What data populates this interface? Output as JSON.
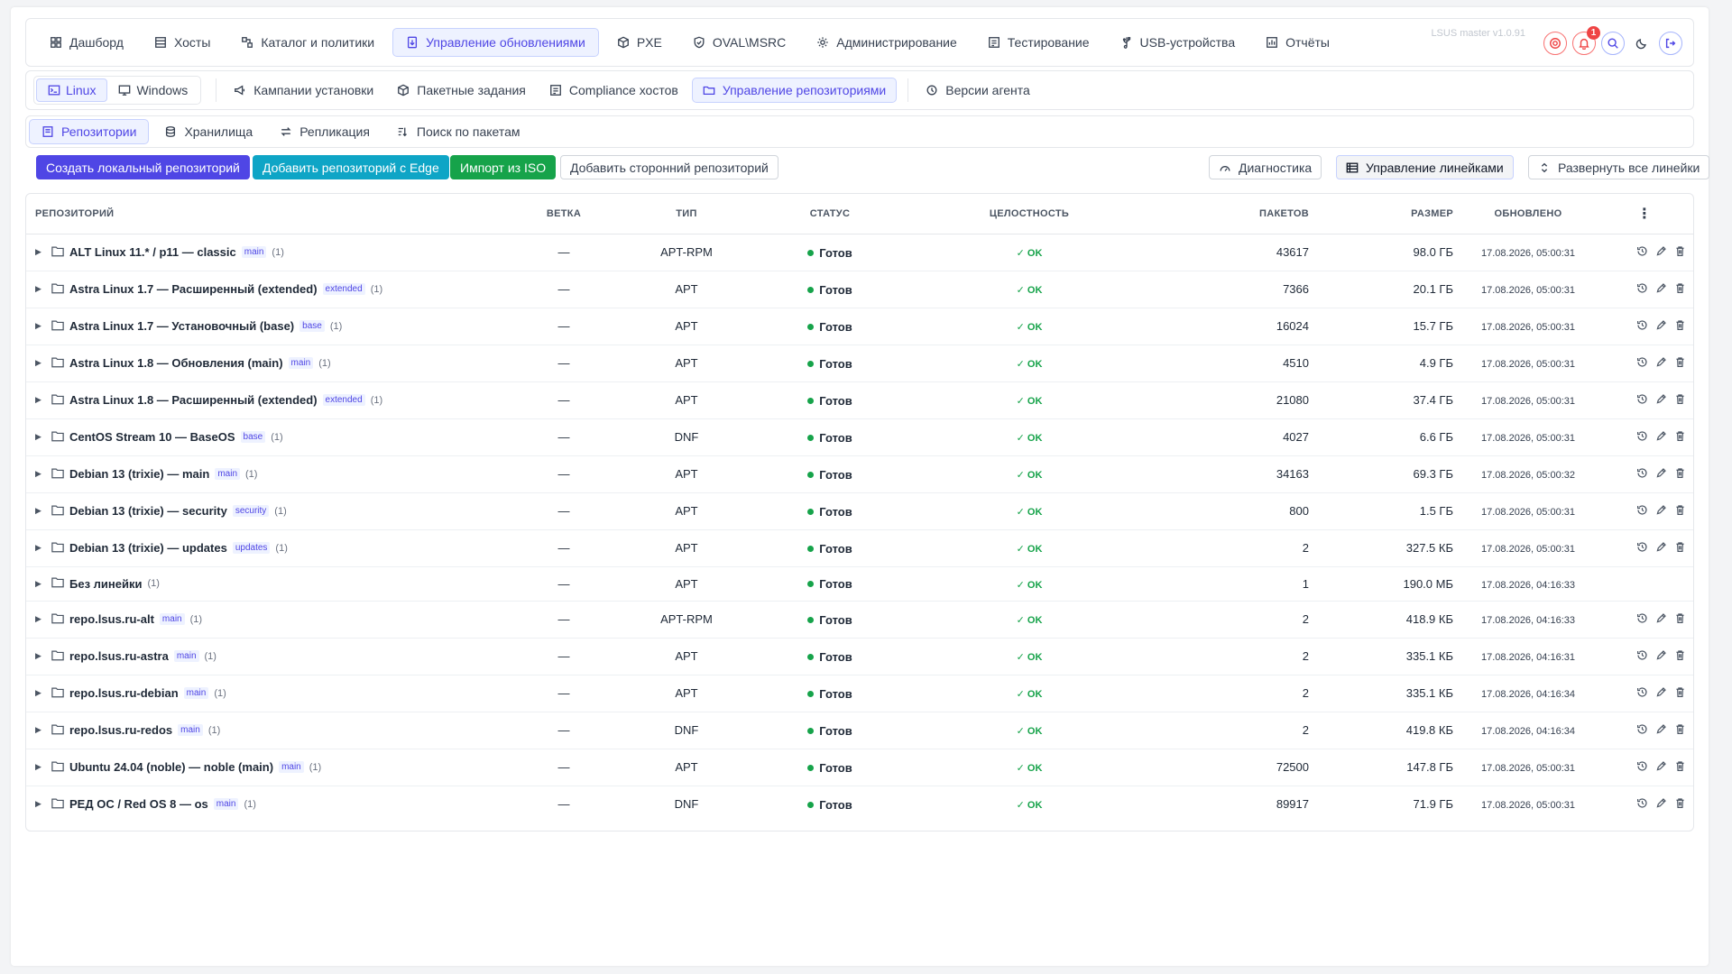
{
  "topnav": {
    "items": [
      {
        "label": "Дашборд",
        "icon": "dashboard-icon"
      },
      {
        "label": "Хосты",
        "icon": "server-icon"
      },
      {
        "label": "Каталог и политики",
        "icon": "catalog-icon"
      },
      {
        "label": "Управление обновлениями",
        "icon": "update-icon",
        "active": true
      },
      {
        "label": "PXE",
        "icon": "cube-icon"
      },
      {
        "label": "OVAL\\MSRC",
        "icon": "shield-icon"
      },
      {
        "label": "Администрирование",
        "icon": "gear-icon"
      },
      {
        "label": "Тестирование",
        "icon": "test-icon"
      },
      {
        "label": "USB-устройства",
        "icon": "usb-icon"
      },
      {
        "label": "Отчёты",
        "icon": "report-icon"
      }
    ],
    "version": "LSUS master v1.0.91",
    "notification_count": "1"
  },
  "subnav": {
    "os": [
      {
        "label": "Linux",
        "active": true
      },
      {
        "label": "Windows"
      }
    ],
    "items": [
      {
        "label": "Кампании установки"
      },
      {
        "label": "Пакетные задания"
      },
      {
        "label": "Compliance хостов"
      },
      {
        "label": "Управление репозиториями",
        "active": true
      },
      {
        "label": "Версии агента"
      }
    ]
  },
  "tabs": [
    {
      "label": "Репозитории",
      "active": true
    },
    {
      "label": "Хранилища"
    },
    {
      "label": "Репликация"
    },
    {
      "label": "Поиск по пакетам"
    }
  ],
  "toolbar": {
    "create_local": "Создать локальный репозиторий",
    "add_edge": "Добавить репозиторий с Edge",
    "import_iso": "Импорт из ISO",
    "add_external": "Добавить сторонний репозиторий",
    "diagnostics": "Диагностика",
    "manage_lines": "Управление линейками",
    "expand_all": "Развернуть все линейки"
  },
  "table": {
    "headers": {
      "repo": "Репозиторий",
      "branch": "Ветка",
      "type": "Тип",
      "status": "Статус",
      "integrity": "Целостность",
      "packages": "Пакетов",
      "size": "Размер",
      "updated": "Обновлено"
    },
    "rows": [
      {
        "name": "ALT Linux 11.* / p11 — classic",
        "tag": "main",
        "count": "(1)",
        "branch": "—",
        "type": "APT-RPM",
        "status": "Готов",
        "integrity": "✓ OK",
        "packages": "43617",
        "size": "98.0 ГБ",
        "updated": "17.08.2026, 05:00:31",
        "actions": true
      },
      {
        "name": "Astra Linux 1.7 — Расширенный (extended)",
        "tag": "extended",
        "count": "(1)",
        "branch": "—",
        "type": "APT",
        "status": "Готов",
        "integrity": "✓ OK",
        "packages": "7366",
        "size": "20.1 ГБ",
        "updated": "17.08.2026, 05:00:31",
        "actions": true
      },
      {
        "name": "Astra Linux 1.7 — Установочный (base)",
        "tag": "base",
        "count": "(1)",
        "branch": "—",
        "type": "APT",
        "status": "Готов",
        "integrity": "✓ OK",
        "packages": "16024",
        "size": "15.7 ГБ",
        "updated": "17.08.2026, 05:00:31",
        "actions": true
      },
      {
        "name": "Astra Linux 1.8 — Обновления (main)",
        "tag": "main",
        "count": "(1)",
        "branch": "—",
        "type": "APT",
        "status": "Готов",
        "integrity": "✓ OK",
        "packages": "4510",
        "size": "4.9 ГБ",
        "updated": "17.08.2026, 05:00:31",
        "actions": true
      },
      {
        "name": "Astra Linux 1.8 — Расширенный (extended)",
        "tag": "extended",
        "count": "(1)",
        "branch": "—",
        "type": "APT",
        "status": "Готов",
        "integrity": "✓ OK",
        "packages": "21080",
        "size": "37.4 ГБ",
        "updated": "17.08.2026, 05:00:31",
        "actions": true
      },
      {
        "name": "CentOS Stream 10 — BaseOS",
        "tag": "base",
        "count": "(1)",
        "branch": "—",
        "type": "DNF",
        "status": "Готов",
        "integrity": "✓ OK",
        "packages": "4027",
        "size": "6.6 ГБ",
        "updated": "17.08.2026, 05:00:31",
        "actions": true
      },
      {
        "name": "Debian 13 (trixie) — main",
        "tag": "main",
        "count": "(1)",
        "branch": "—",
        "type": "APT",
        "status": "Готов",
        "integrity": "✓ OK",
        "packages": "34163",
        "size": "69.3 ГБ",
        "updated": "17.08.2026, 05:00:32",
        "actions": true
      },
      {
        "name": "Debian 13 (trixie) — security",
        "tag": "security",
        "count": "(1)",
        "branch": "—",
        "type": "APT",
        "status": "Готов",
        "integrity": "✓ OK",
        "packages": "800",
        "size": "1.5 ГБ",
        "updated": "17.08.2026, 05:00:31",
        "actions": true
      },
      {
        "name": "Debian 13 (trixie) — updates",
        "tag": "updates",
        "count": "(1)",
        "branch": "—",
        "type": "APT",
        "status": "Готов",
        "integrity": "✓ OK",
        "packages": "2",
        "size": "327.5 КБ",
        "updated": "17.08.2026, 05:00:31",
        "actions": true
      },
      {
        "name": "Без линейки",
        "tag": "",
        "count": "(1)",
        "branch": "—",
        "type": "APT",
        "status": "Готов",
        "integrity": "✓ OK",
        "packages": "1",
        "size": "190.0 МБ",
        "updated": "17.08.2026, 04:16:33",
        "actions": false
      },
      {
        "name": "repo.lsus.ru-alt",
        "tag": "main",
        "count": "(1)",
        "branch": "—",
        "type": "APT-RPM",
        "status": "Готов",
        "integrity": "✓ OK",
        "packages": "2",
        "size": "418.9 КБ",
        "updated": "17.08.2026, 04:16:33",
        "actions": true
      },
      {
        "name": "repo.lsus.ru-astra",
        "tag": "main",
        "count": "(1)",
        "branch": "—",
        "type": "APT",
        "status": "Готов",
        "integrity": "✓ OK",
        "packages": "2",
        "size": "335.1 КБ",
        "updated": "17.08.2026, 04:16:31",
        "actions": true
      },
      {
        "name": "repo.lsus.ru-debian",
        "tag": "main",
        "count": "(1)",
        "branch": "—",
        "type": "APT",
        "status": "Готов",
        "integrity": "✓ OK",
        "packages": "2",
        "size": "335.1 КБ",
        "updated": "17.08.2026, 04:16:34",
        "actions": true
      },
      {
        "name": "repo.lsus.ru-redos",
        "tag": "main",
        "count": "(1)",
        "branch": "—",
        "type": "DNF",
        "status": "Готов",
        "integrity": "✓ OK",
        "packages": "2",
        "size": "419.8 КБ",
        "updated": "17.08.2026, 04:16:34",
        "actions": true
      },
      {
        "name": "Ubuntu 24.04 (noble) — noble (main)",
        "tag": "main",
        "count": "(1)",
        "branch": "—",
        "type": "APT",
        "status": "Готов",
        "integrity": "✓ OK",
        "packages": "72500",
        "size": "147.8 ГБ",
        "updated": "17.08.2026, 05:00:31",
        "actions": true
      },
      {
        "name": "РЕД ОС / Red OS 8 — os",
        "tag": "main",
        "count": "(1)",
        "branch": "—",
        "type": "DNF",
        "status": "Готов",
        "integrity": "✓ OK",
        "packages": "89917",
        "size": "71.9 ГБ",
        "updated": "17.08.2026, 05:00:31",
        "actions": true
      }
    ]
  },
  "colors": {
    "accent": "#4f46e5",
    "teal": "#0ea5c6",
    "success": "#16a34a",
    "danger": "#ef4444"
  }
}
